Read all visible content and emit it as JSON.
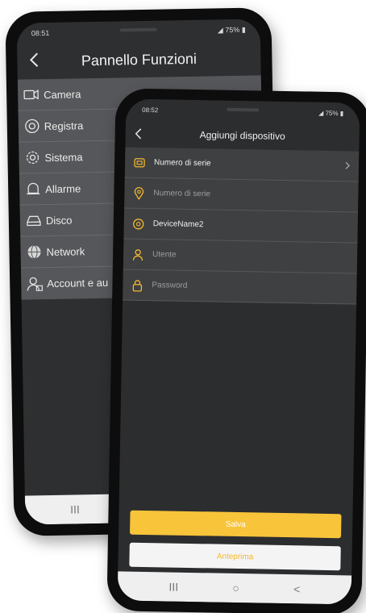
{
  "back_phone": {
    "status": {
      "time": "08:51",
      "battery": "75%"
    },
    "title": "Pannello Funzioni",
    "menu": [
      {
        "label": "Camera",
        "icon": "camera-icon"
      },
      {
        "label": "Registra",
        "icon": "record-icon"
      },
      {
        "label": "Sistema",
        "icon": "gear-icon"
      },
      {
        "label": "Allarme",
        "icon": "bell-icon"
      },
      {
        "label": "Disco",
        "icon": "disk-icon"
      },
      {
        "label": "Network",
        "icon": "globe-icon"
      },
      {
        "label": "Account e au",
        "icon": "account-icon"
      }
    ],
    "nav": {
      "recent": "III"
    }
  },
  "front_phone": {
    "status": {
      "time": "08:52",
      "battery": "75%"
    },
    "title": "Aggiungi dispositivo",
    "fields": [
      {
        "label": "Numero di serie",
        "icon": "serial-icon",
        "active": true,
        "chevron": true
      },
      {
        "label": "Numero di serie",
        "icon": "location-pin-icon",
        "active": false
      },
      {
        "label": "DeviceName2",
        "icon": "device-icon",
        "active": true
      },
      {
        "label": "Utente",
        "icon": "user-icon",
        "active": false
      },
      {
        "label": "Password",
        "icon": "lock-icon",
        "active": false
      }
    ],
    "buttons": {
      "save": "Salva",
      "preview": "Anteprima"
    },
    "nav": {
      "recent": "III",
      "home": "○",
      "back": "<"
    },
    "colors": {
      "accent": "#f8c43a"
    }
  }
}
